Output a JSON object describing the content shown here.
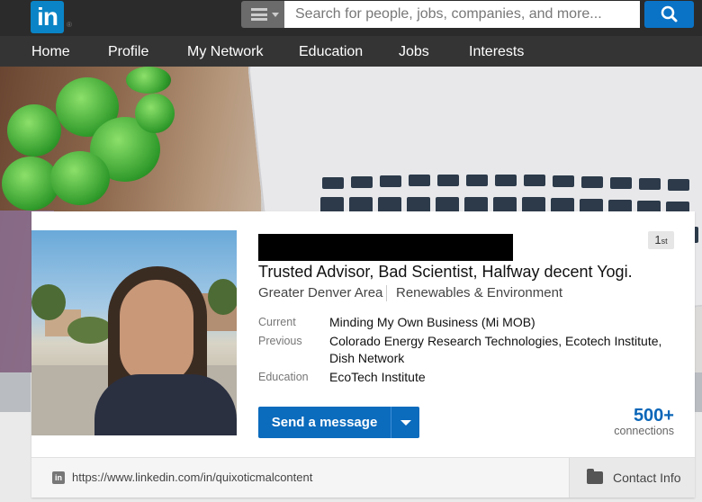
{
  "header": {
    "logo_text": "in",
    "search": {
      "placeholder": "Search for people, jobs, companies, and more..."
    }
  },
  "nav": {
    "items": [
      {
        "label": "Home"
      },
      {
        "label": "Profile"
      },
      {
        "label": "My Network"
      },
      {
        "label": "Education"
      },
      {
        "label": "Jobs"
      },
      {
        "label": "Interests"
      }
    ]
  },
  "profile": {
    "degree": "1",
    "degree_suffix": "st",
    "headline": "Trusted Advisor, Bad Scientist, Halfway decent Yogi.",
    "location": "Greater Denver Area",
    "industry": "Renewables & Environment",
    "current_label": "Current",
    "current": "Minding My Own Business (Mi MOB)",
    "previous_label": "Previous",
    "previous": "Colorado Energy Research Technologies, Ecotech Institute, Dish Network",
    "education_label": "Education",
    "education": "EcoTech Institute",
    "send_message_label": "Send a message",
    "connections_count": "500+",
    "connections_label": "connections",
    "public_url": "https://www.linkedin.com/in/quixoticmalcontent",
    "contact_info_label": "Contact Info"
  },
  "colors": {
    "brand": "#0a84c6",
    "button": "#0b6bbd",
    "topbar": "#2b2b2b",
    "nav": "#343434"
  }
}
